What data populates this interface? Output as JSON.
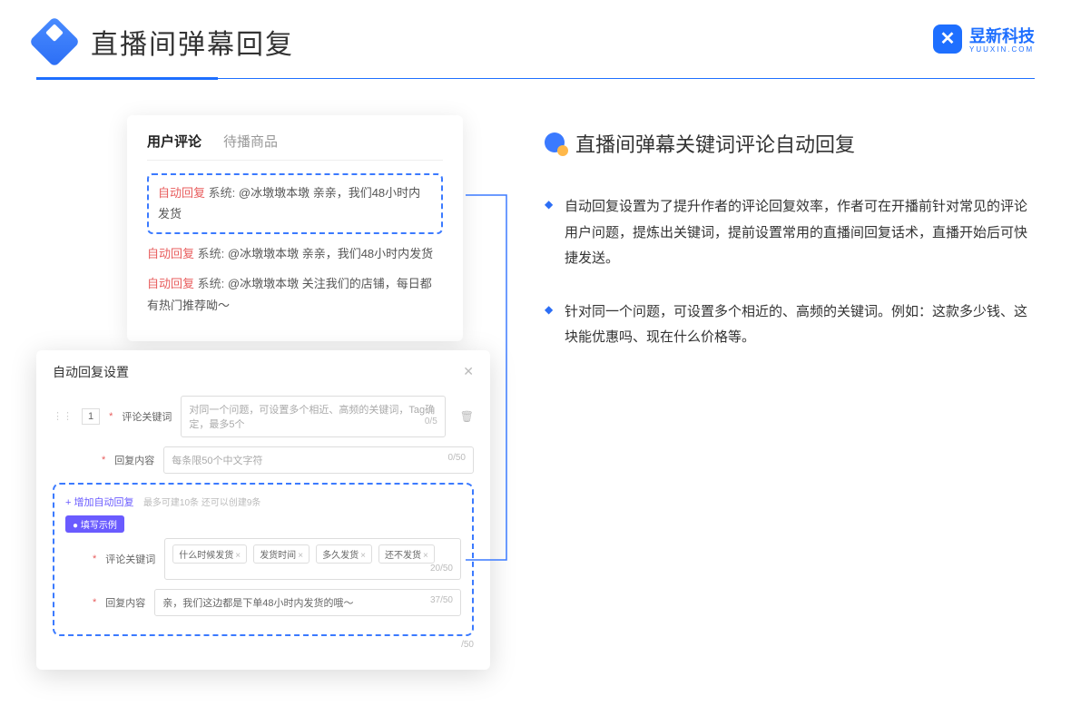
{
  "header": {
    "title": "直播间弹幕回复",
    "brand_name": "昱新科技",
    "brand_sub": "YUUXIN.COM"
  },
  "card_a": {
    "tab_active": "用户评论",
    "tab_inactive": "待播商品",
    "row1": {
      "tag": "自动回复",
      "sys": "系统:",
      "text": "@冰墩墩本墩 亲亲，我们48小时内发货"
    },
    "row2": {
      "tag": "自动回复",
      "sys": "系统:",
      "text": "@冰墩墩本墩 亲亲，我们48小时内发货"
    },
    "row3": {
      "tag": "自动回复",
      "sys": "系统:",
      "text": "@冰墩墩本墩 关注我们的店铺，每日都有热门推荐呦～"
    }
  },
  "card_b": {
    "title": "自动回复设置",
    "num": "1",
    "label_keyword": "评论关键词",
    "placeholder_keyword": "对同一个问题，可设置多个相近、高频的关键词，Tag确定，最多5个",
    "count_keyword": "0/5",
    "label_reply": "回复内容",
    "placeholder_reply": "每条限50个中文字符",
    "count_reply": "0/50",
    "add_link": "+ 增加自动回复",
    "add_hint": "最多可建10条 还可以创建9条",
    "example_badge": "● 填写示例",
    "ex_label_kw": "评论关键词",
    "ex_tags": [
      "什么时候发货",
      "发货时间",
      "多久发货",
      "还不发货"
    ],
    "ex_count_kw": "20/50",
    "ex_label_reply": "回复内容",
    "ex_reply_text": "亲，我们这边都是下单48小时内发货的哦～",
    "ex_count_reply": "37/50",
    "outer_count": "/50"
  },
  "right": {
    "section_title": "直播间弹幕关键词评论自动回复",
    "bullet1": "自动回复设置为了提升作者的评论回复效率，作者可在开播前针对常见的评论用户问题，提炼出关键词，提前设置常用的直播间回复话术，直播开始后可快捷发送。",
    "bullet2": "针对同一个问题，可设置多个相近的、高频的关键词。例如：这款多少钱、这块能优惠吗、现在什么价格等。"
  }
}
